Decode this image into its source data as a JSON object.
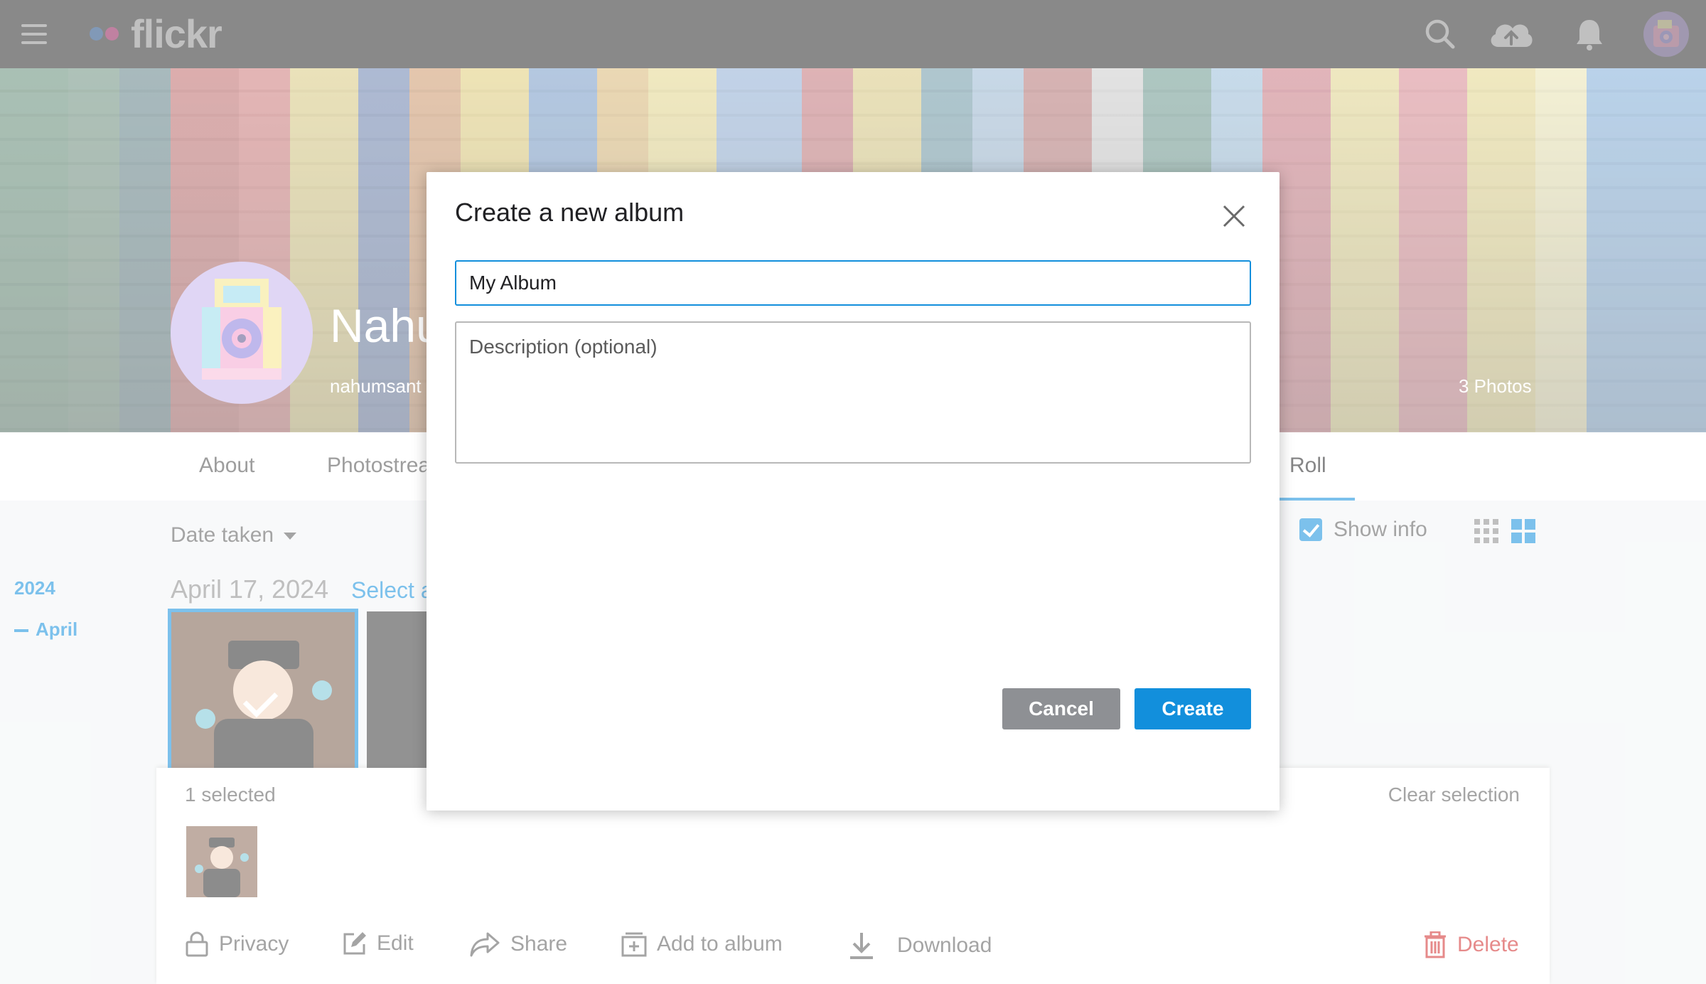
{
  "topnav": {
    "brand": "flickr",
    "brand_dot_colors": [
      "#0063dc",
      "#ff0084"
    ]
  },
  "profile": {
    "name": "Nahu",
    "username": "nahumsant",
    "photo_count": "3 Photos"
  },
  "subnav": {
    "items": [
      "About",
      "Photostrea",
      "Roll"
    ]
  },
  "camera_roll": {
    "sort_label": "Date taken",
    "show_info_label": "Show info",
    "show_info_checked": true,
    "year": "2024",
    "month": "April",
    "date_heading": "April 17, 2024",
    "select_all": "Select a"
  },
  "selection_bar": {
    "count_label": "1 selected",
    "clear_label": "Clear selection",
    "actions": {
      "privacy": "Privacy",
      "edit": "Edit",
      "share": "Share",
      "add_to_album": "Add to album",
      "download": "Download",
      "delete": "Delete"
    }
  },
  "modal": {
    "title": "Create a new album",
    "album_name_value": "My Album",
    "description_placeholder": "Description (optional)",
    "cancel_label": "Cancel",
    "create_label": "Create"
  },
  "colors": {
    "accent": "#128fdc",
    "danger": "#d12a2a",
    "cancel_button": "#8e9094"
  }
}
